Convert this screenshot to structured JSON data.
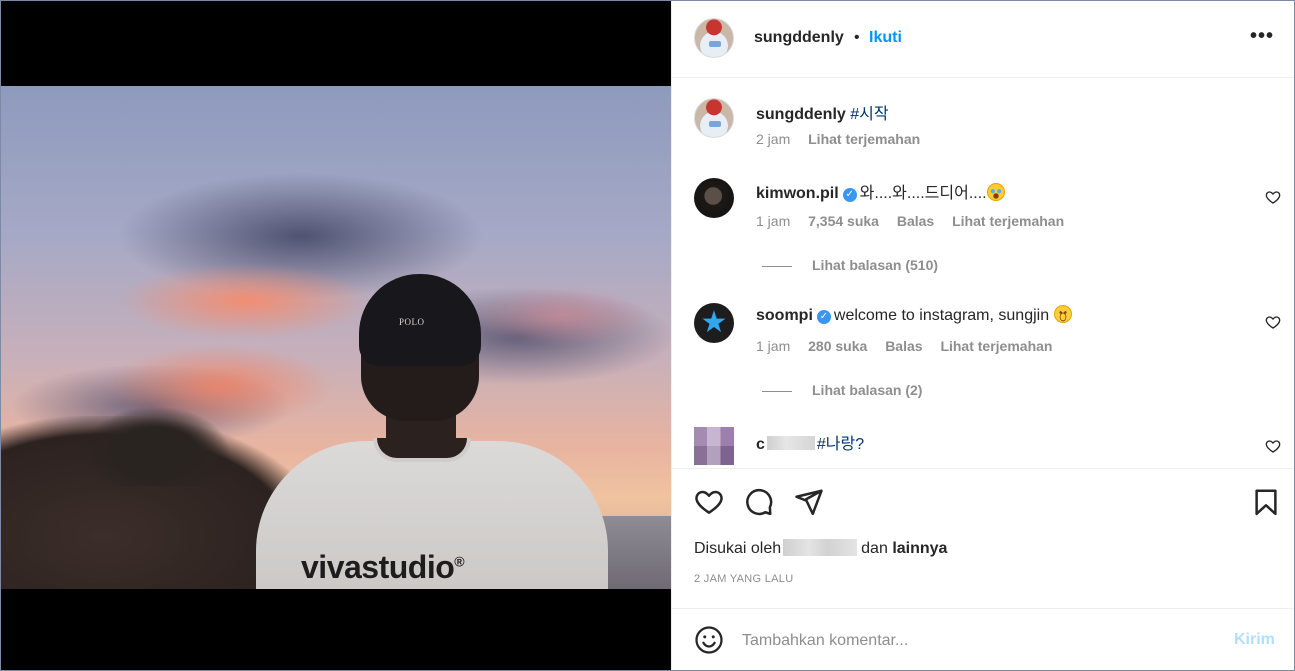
{
  "post": {
    "image_brand_text": "vivastudio",
    "image_brand_mark": "®",
    "image_cap_text": "POLO"
  },
  "header": {
    "username": "sungddenly",
    "separator": "•",
    "follow_label": "Ikuti",
    "more_label": "•••"
  },
  "caption": {
    "username": "sungddenly",
    "tag": "#시작",
    "time": "2 jam",
    "translate_label": "Lihat terjemahan"
  },
  "comments": [
    {
      "username": "kimwon.pil",
      "verified": true,
      "text": "와....와....드디어....",
      "emoji": "crying-face-emoji",
      "time": "1 jam",
      "likes": "7,354 suka",
      "reply_label": "Balas",
      "translate_label": "Lihat terjemahan",
      "view_replies": "Lihat balasan (510)"
    },
    {
      "username": "soompi",
      "verified": true,
      "text": "welcome to instagram, sungjin",
      "emoji": "smiling-face-emoji",
      "time": "1 jam",
      "likes": "280 suka",
      "reply_label": "Balas",
      "translate_label": "Lihat terjemahan",
      "view_replies": "Lihat balasan (2)"
    },
    {
      "username_visible_prefix": "c",
      "tag": "#나랑?"
    }
  ],
  "actions": {
    "liked_by_prefix": "Disukai oleh",
    "liked_by_and": "dan",
    "liked_by_others": "lainnya",
    "posted_time": "2 JAM YANG LALU"
  },
  "add_comment": {
    "placeholder": "Tambahkan komentar...",
    "post_label": "Kirim"
  },
  "colors": {
    "accent": "#0095f6",
    "tag": "#00376b",
    "muted": "#8e8e8e",
    "post_disabled": "#b2dffc",
    "verified": "#3897f0"
  }
}
